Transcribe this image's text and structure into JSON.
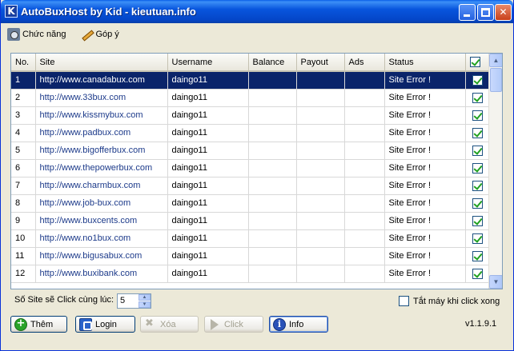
{
  "window": {
    "title": "AutoBuxHost by Kid - kieutuan.info",
    "app_icon_glyph": "K",
    "controls": {
      "minimize": "minimize-icon",
      "maximize": "maximize-icon",
      "close": "✕"
    }
  },
  "menu": [
    {
      "label": "Chức năng",
      "icon": "gear-icon"
    },
    {
      "label": "Góp ý",
      "icon": "pen-icon"
    }
  ],
  "table": {
    "columns": [
      "No.",
      "Site",
      "Username",
      "Balance",
      "Payout",
      "Ads",
      "Status",
      "✔"
    ],
    "rows": [
      {
        "no": "1",
        "site": "http://www.canadabux.com",
        "username": "daingo11",
        "balance": "",
        "payout": "",
        "ads": "",
        "status": "Site Error !",
        "checked": true,
        "selected": true
      },
      {
        "no": "2",
        "site": "http://www.33bux.com",
        "username": "daingo11",
        "balance": "",
        "payout": "",
        "ads": "",
        "status": "Site Error !",
        "checked": true
      },
      {
        "no": "3",
        "site": "http://www.kissmybux.com",
        "username": "daingo11",
        "balance": "",
        "payout": "",
        "ads": "",
        "status": "Site Error !",
        "checked": true
      },
      {
        "no": "4",
        "site": "http://www.padbux.com",
        "username": "daingo11",
        "balance": "",
        "payout": "",
        "ads": "",
        "status": "Site Error !",
        "checked": true
      },
      {
        "no": "5",
        "site": "http://www.bigofferbux.com",
        "username": "daingo11",
        "balance": "",
        "payout": "",
        "ads": "",
        "status": "Site Error !",
        "checked": true
      },
      {
        "no": "6",
        "site": "http://www.thepowerbux.com",
        "username": "daingo11",
        "balance": "",
        "payout": "",
        "ads": "",
        "status": "Site Error !",
        "checked": true
      },
      {
        "no": "7",
        "site": "http://www.charmbux.com",
        "username": "daingo11",
        "balance": "",
        "payout": "",
        "ads": "",
        "status": "Site Error !",
        "checked": true
      },
      {
        "no": "8",
        "site": "http://www.job-bux.com",
        "username": "daingo11",
        "balance": "",
        "payout": "",
        "ads": "",
        "status": "Site Error !",
        "checked": true
      },
      {
        "no": "9",
        "site": "http://www.buxcents.com",
        "username": "daingo11",
        "balance": "",
        "payout": "",
        "ads": "",
        "status": "Site Error !",
        "checked": true
      },
      {
        "no": "10",
        "site": "http://www.no1bux.com",
        "username": "daingo11",
        "balance": "",
        "payout": "",
        "ads": "",
        "status": "Site Error !",
        "checked": true
      },
      {
        "no": "11",
        "site": "http://www.bigusabux.com",
        "username": "daingo11",
        "balance": "",
        "payout": "",
        "ads": "",
        "status": "Site Error !",
        "checked": true
      },
      {
        "no": "12",
        "site": "http://www.buxibank.com",
        "username": "daingo11",
        "balance": "",
        "payout": "",
        "ads": "",
        "status": "Site Error !",
        "checked": true
      }
    ]
  },
  "settings": {
    "site_count_label": "Số Site sẽ Click cùng lúc:",
    "site_count_value": "5",
    "shutdown_label": "Tắt máy khi click xong",
    "shutdown_checked": false
  },
  "buttons": {
    "them": "Thêm",
    "login": "Login",
    "xoa": "Xóa",
    "click": "Click",
    "info": "Info"
  },
  "version": "v1.1.9.1",
  "colors": {
    "selection": "#0a246a",
    "titlebar": "#0855dd",
    "check": "#21a121"
  }
}
